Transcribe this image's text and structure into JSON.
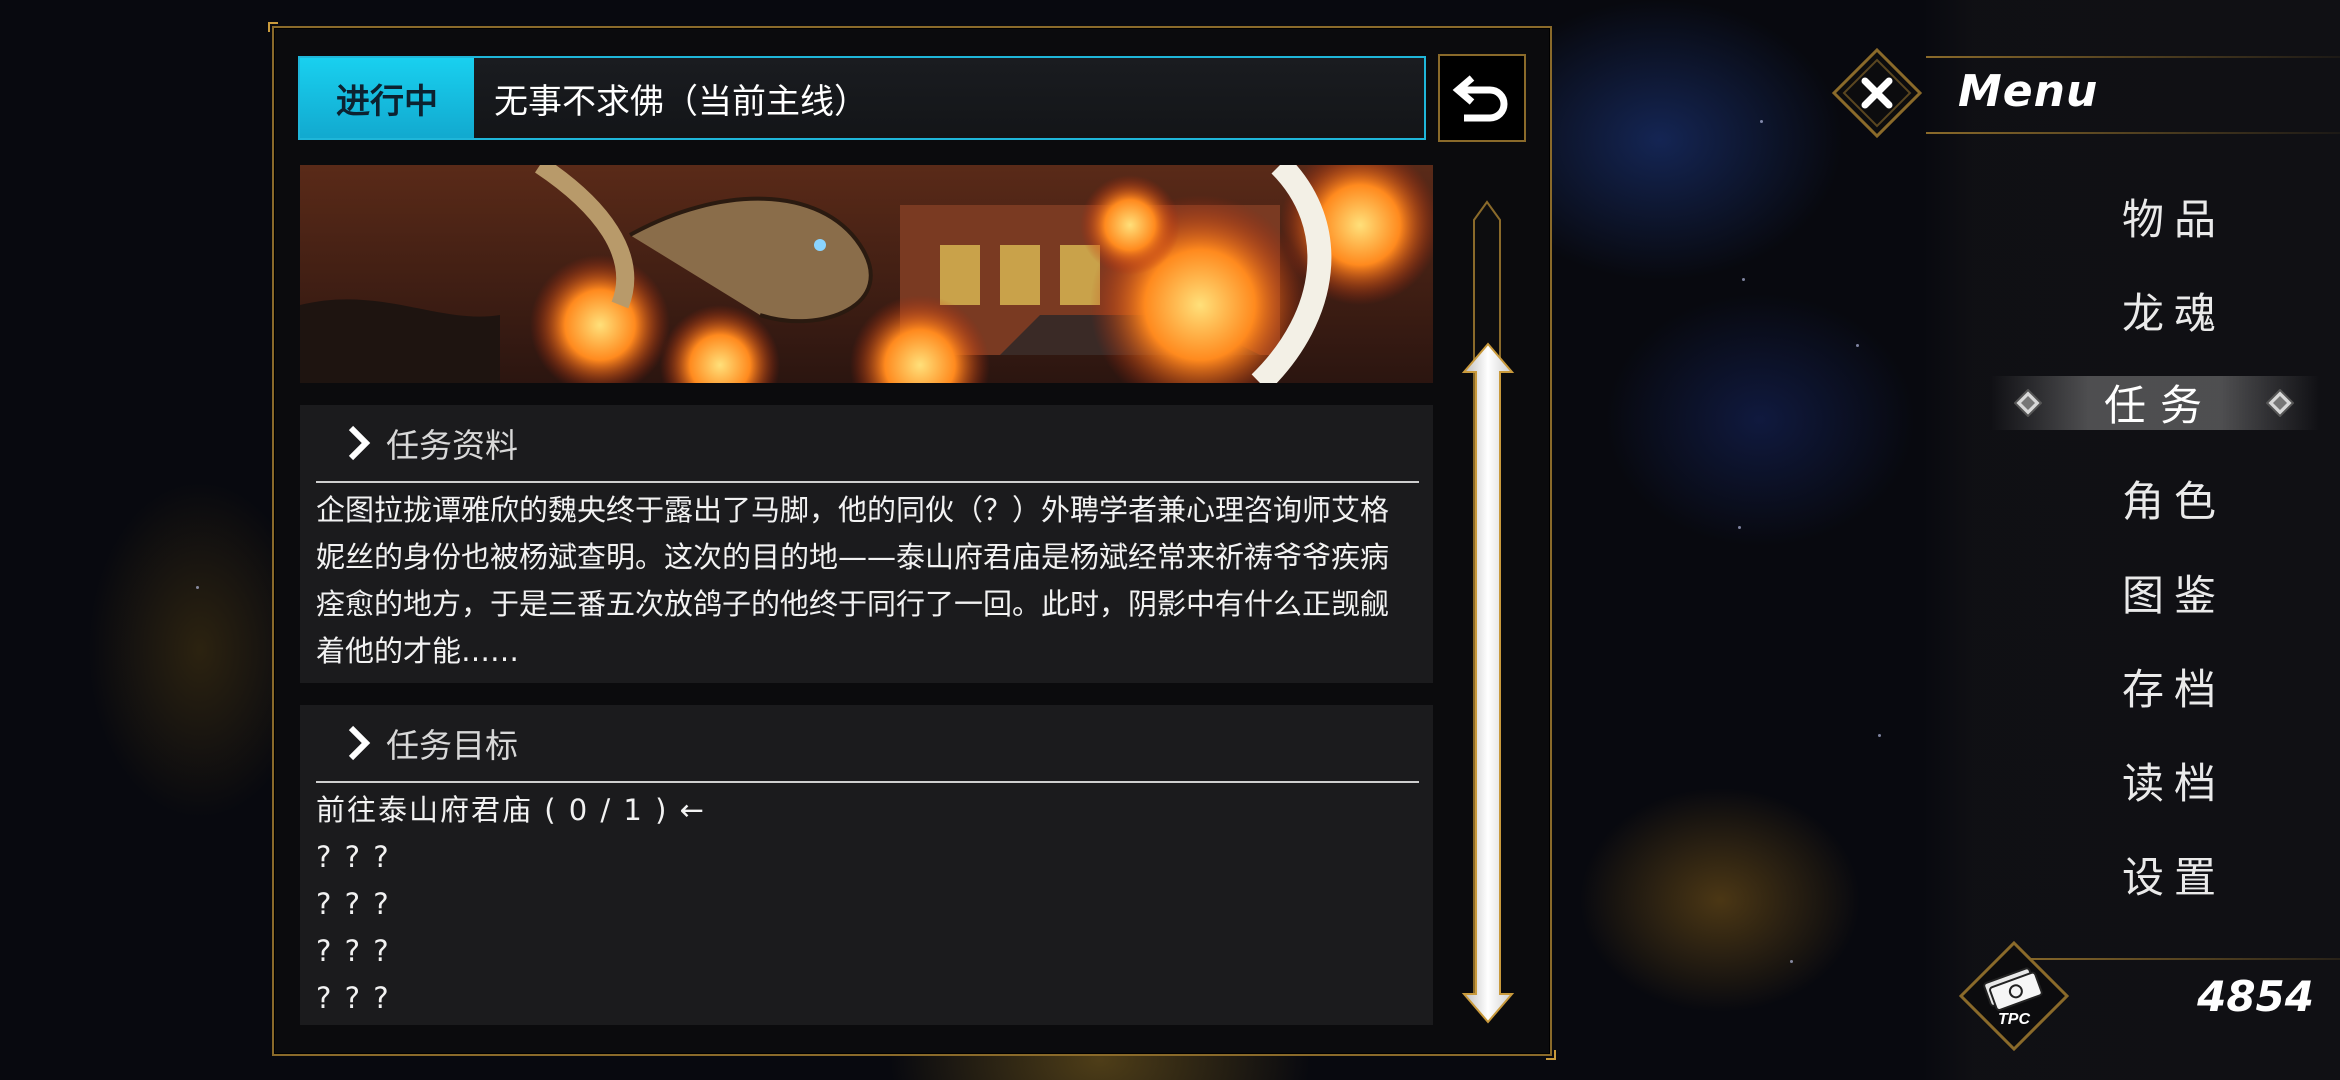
{
  "quest": {
    "status": "进行中",
    "title": "无事不求佛（当前主线）"
  },
  "info": {
    "heading": "任务资料",
    "text": "企图拉拢谭雅欣的魏央终于露出了马脚，他的同伙（？）外聘学者兼心理咨询师艾格妮丝的身份也被杨斌查明。这次的目的地——泰山府君庙是杨斌经常来祈祷爷爷疾病痊愈的地方，于是三番五次放鸽子的他终于同行了一回。此时，阴影中有什么正觊觎着他的才能……"
  },
  "goals": {
    "heading": "任务目标",
    "items": [
      "前往泰山府君庙 ( 0 / 1 ) ←",
      "? ? ?",
      "? ? ?",
      "? ? ?",
      "? ? ?"
    ]
  },
  "menu": {
    "title": "Menu",
    "items": [
      "物品",
      "龙魂",
      "任务",
      "角色",
      "图鉴",
      "存档",
      "读档",
      "设置"
    ],
    "active": "任务"
  },
  "currency": {
    "label": "TPC",
    "value": "4854"
  },
  "colors": {
    "accent_cyan": "#19d0ef",
    "gold": "#c99a3c"
  }
}
